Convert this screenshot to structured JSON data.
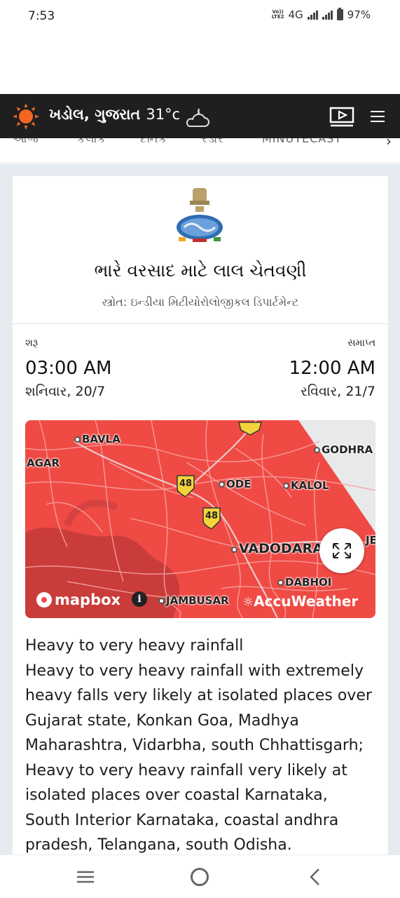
{
  "status_bar": {
    "time": "7:53",
    "volte_line1": "Vo))",
    "volte_line2": "LTE2",
    "network": "4G",
    "battery_percent": "97%"
  },
  "header": {
    "location": "ખડોલ, ગુજરાત",
    "temperature": "31°c",
    "weather_icon": "partly-cloudy-night-icon",
    "brand_icon": "sun-icon",
    "accent_color": "#f26522"
  },
  "tabs": [
    {
      "label": "આજ"
    },
    {
      "label": "કલાક"
    },
    {
      "label": "દૈનિક"
    },
    {
      "label": "રડાર"
    },
    {
      "label": "MINUTECAST"
    }
  ],
  "alert": {
    "title": "ભારે વરસાદ માટે લાલ ચેતવણી",
    "source": "સ્ત્રોત: ઇન્ડીયા મિટીયોરોલોજીકલ ડિપાર્ટમેન્ટ",
    "start_label": "શરૂ",
    "start_time": "03:00 AM",
    "start_day": "શનિવાર, 20/7",
    "end_label": "સમાપ્ત",
    "end_time": "12:00 AM",
    "end_day": "રવિવાર, 21/7",
    "map_color": "#f04a45"
  },
  "map": {
    "places": [
      "BAVLA",
      "AGAR",
      "GODHRA",
      "ODE",
      "KALOL",
      "VADODARA",
      "JE",
      "DABHOI",
      "JAMBUSAR"
    ],
    "highway_shields": [
      "48",
      "48"
    ],
    "mapbox_label": "mapbox",
    "info_label": "i",
    "accuweather_label": "AccuWeather"
  },
  "description": {
    "line1": "Heavy to very heavy rainfall",
    "body": "Heavy to very heavy rainfall with extremely heavy falls very likely at isolated places over Gujarat state, Konkan Goa, Madhya Maharashtra, Vidarbha, south Chhattisgarh; Heavy to very heavy rainfall very likely at isolated places over coastal Karnataka, South Interior Karnataka, coastal andhra pradesh, Telangana, south Odisha."
  }
}
